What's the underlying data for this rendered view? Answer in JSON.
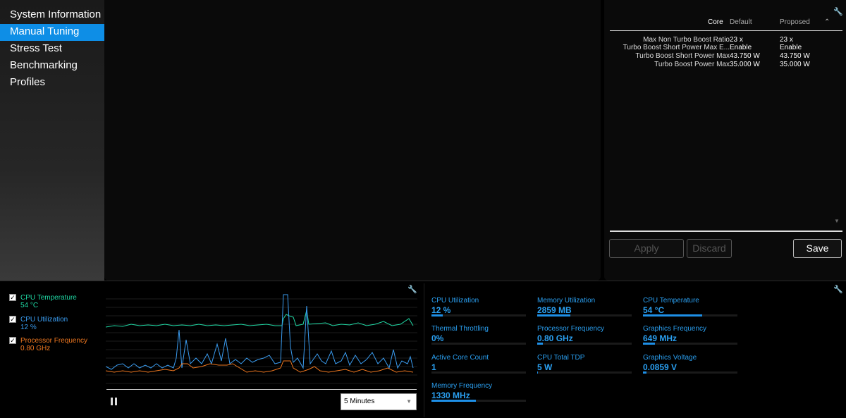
{
  "sidebar": {
    "items": [
      {
        "label": "System Information",
        "active": false
      },
      {
        "label": "Manual Tuning",
        "active": true
      },
      {
        "label": "Stress Test",
        "active": false
      },
      {
        "label": "Benchmarking",
        "active": false
      },
      {
        "label": "Profiles",
        "active": false
      }
    ]
  },
  "tuning": {
    "headers": {
      "core": "Core",
      "default": "Default",
      "proposed": "Proposed"
    },
    "rows": [
      {
        "name": "Max Non Turbo Boost Ratio",
        "default": "23 x",
        "proposed": "23 x"
      },
      {
        "name": "Turbo Boost Short Power Max E...",
        "default": "Enable",
        "proposed": "Enable"
      },
      {
        "name": "Turbo Boost Short Power Max",
        "default": "43.750 W",
        "proposed": "43.750 W"
      },
      {
        "name": "Turbo Boost Power Max",
        "default": "35.000 W",
        "proposed": "35.000 W"
      }
    ],
    "buttons": {
      "apply": "Apply",
      "discard": "Discard",
      "save": "Save"
    }
  },
  "graph": {
    "legend": [
      {
        "name": "CPU Temperature",
        "value": "54 °C",
        "color": "#1fd8a4",
        "checked": true
      },
      {
        "name": "CPU Utilization",
        "value": "12 %",
        "color": "#3a9cf0",
        "checked": true
      },
      {
        "name": "Processor Frequency",
        "value": "0.80 GHz",
        "color": "#f07820",
        "checked": true
      }
    ],
    "time_range": "5 Minutes"
  },
  "metrics": [
    {
      "label": "CPU Utilization",
      "value": "12 %",
      "fill": 0.12
    },
    {
      "label": "Memory Utilization",
      "value": "2859  MB",
      "fill": 0.35
    },
    {
      "label": "CPU Temperature",
      "value": "54 °C",
      "fill": 0.63
    },
    {
      "label": "Thermal Throttling",
      "value": "0%",
      "fill": 0.0
    },
    {
      "label": "Processor Frequency",
      "value": "0.80 GHz",
      "fill": 0.06
    },
    {
      "label": "Graphics Frequency",
      "value": "649 MHz",
      "fill": 0.13
    },
    {
      "label": "Active Core Count",
      "value": "1",
      "fill": 0.0
    },
    {
      "label": "CPU Total TDP",
      "value": "5 W",
      "fill": 0.01
    },
    {
      "label": "Graphics Voltage",
      "value": "0.0859 V",
      "fill": 0.04
    },
    {
      "label": "Memory Frequency",
      "value": "1330 MHz",
      "fill": 0.47
    }
  ]
}
